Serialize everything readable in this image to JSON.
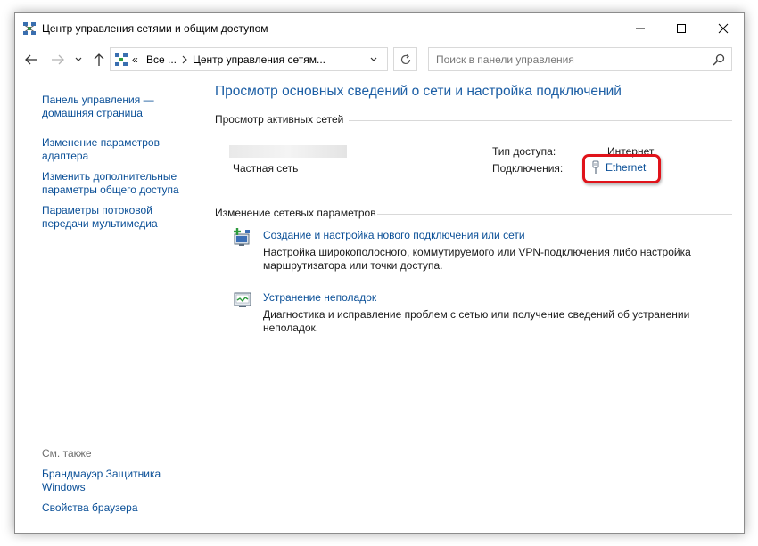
{
  "window": {
    "title": "Центр управления сетями и общим доступом"
  },
  "navbar": {
    "address_prefix": "«",
    "address_parts": [
      "Все ...",
      "Центр управления сетям..."
    ],
    "search_placeholder": "Поиск в панели управления"
  },
  "sidebar": {
    "links": [
      {
        "lines": [
          "Панель управления —",
          "домашняя страница"
        ]
      },
      {
        "lines": [
          "Изменение параметров",
          "адаптера"
        ]
      },
      {
        "lines": [
          "Изменить дополнительные",
          "параметры общего доступа"
        ]
      },
      {
        "lines": [
          "Параметры потоковой",
          "передачи мультимедиа"
        ]
      }
    ],
    "see_also_label": "См. также",
    "see_also": [
      {
        "lines": [
          "Брандмауэр Защитника",
          "Windows"
        ]
      },
      {
        "lines": [
          "Свойства браузера"
        ]
      }
    ]
  },
  "main": {
    "title": "Просмотр основных сведений о сети и настройка подключений",
    "active_networks_label": "Просмотр активных сетей",
    "network": {
      "type": "Частная сеть",
      "access_type_label": "Тип доступа:",
      "access_type_value": "Интернет",
      "connections_label": "Подключения:",
      "connection_name": "Ethernet"
    },
    "change_settings_label": "Изменение сетевых параметров",
    "tasks": [
      {
        "link": "Создание и настройка нового подключения или сети",
        "desc": [
          "Настройка широкополосного, коммутируемого или VPN-подключения либо настройка",
          "маршрутизатора или точки доступа."
        ]
      },
      {
        "link": "Устранение неполадок",
        "desc": [
          "Диагностика и исправление проблем с сетью или получение сведений об устранении",
          "неполадок."
        ]
      }
    ]
  },
  "colors": {
    "link": "#0a4f97",
    "heading": "#1d5fa5",
    "highlight": "#e0131a"
  }
}
